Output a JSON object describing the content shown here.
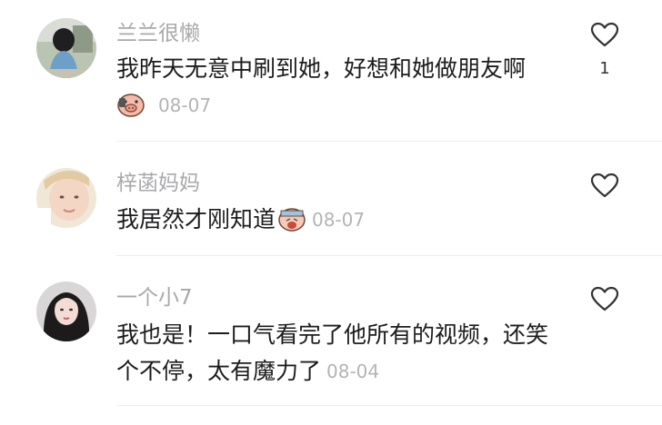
{
  "comments": [
    {
      "username": "兰兰很懒",
      "text": "我昨天无意中刷到她，好想和她做朋友啊",
      "date": "08-07",
      "likes": "1",
      "emoji": "pig-face-emoji"
    },
    {
      "username": "梓菡妈妈",
      "text": "我居然才刚知道",
      "date": "08-07",
      "likes": "",
      "emoji": "crying-face-emoji"
    },
    {
      "username": "一个小7",
      "text_line1": "我也是！一口气看完了他所有的视频，还笑",
      "text_line2": "个不停，太有魔力了",
      "date": "08-04",
      "likes": ""
    }
  ],
  "icons": {
    "like": "heart-outline-icon"
  },
  "colors": {
    "username": "#a9a9ad",
    "text": "#1c1c1e",
    "date": "#b4b4b8",
    "divider": "#ededed"
  }
}
